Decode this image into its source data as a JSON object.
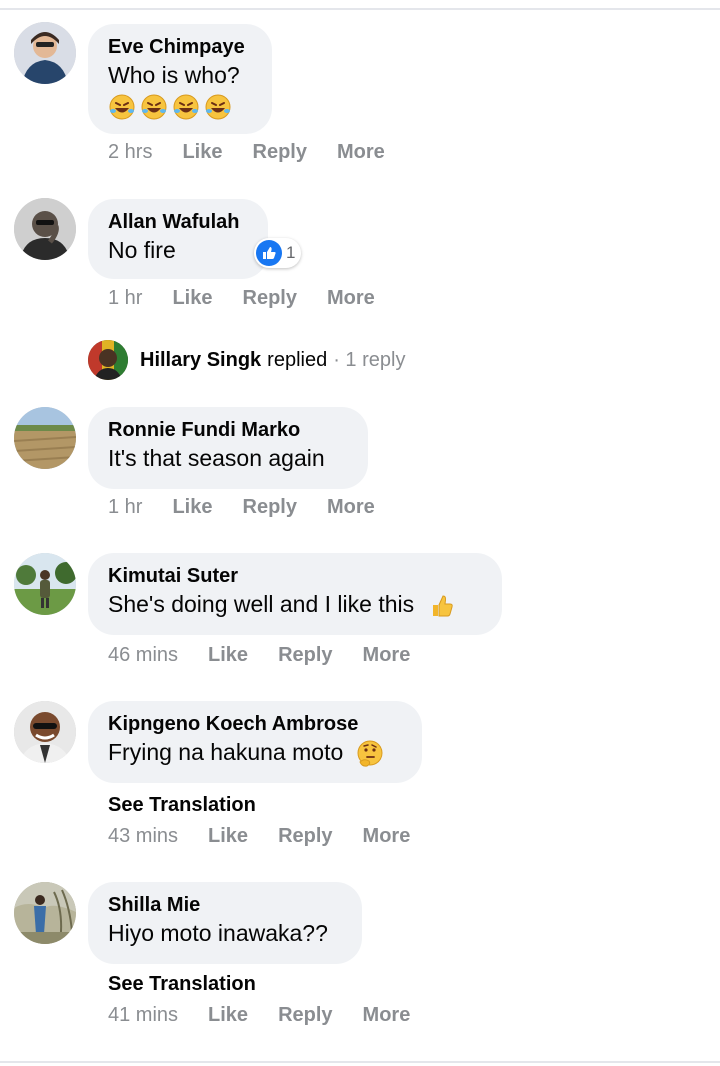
{
  "comments": [
    {
      "author": "Eve Chimpaye",
      "text": "Who is who?",
      "emojis": [
        "laughing-crying-emoji",
        "laughing-crying-emoji",
        "laughing-crying-emoji",
        "laughing-crying-emoji"
      ],
      "time": "2 hrs",
      "like": "Like",
      "reply": "Reply",
      "more": "More"
    },
    {
      "author": "Allan Wafulah",
      "text": "No fire",
      "reaction_count": "1",
      "time": "1 hr",
      "like": "Like",
      "reply": "Reply",
      "more": "More"
    },
    {
      "author": "Ronnie Fundi Marko",
      "text": "It's that season again",
      "time": "1 hr",
      "like": "Like",
      "reply": "Reply",
      "more": "More"
    },
    {
      "author": "Kimutai Suter",
      "text": "She's doing well and I like this",
      "emoji": "thumbs-up-emoji",
      "time": "46 mins",
      "like": "Like",
      "reply": "Reply",
      "more": "More"
    },
    {
      "author": "Kipngeno Koech Ambrose",
      "text": "Frying na hakuna moto",
      "emoji": "thinking-face-emoji",
      "see_translation": "See Translation",
      "time": "43 mins",
      "like": "Like",
      "reply": "Reply",
      "more": "More"
    },
    {
      "author": "Shilla Mie",
      "text": "Hiyo moto inawaka??",
      "see_translation": "See Translation",
      "time": "41 mins",
      "like": "Like",
      "reply": "Reply",
      "more": "More"
    }
  ],
  "reply_thread": {
    "name": "Hillary Singk",
    "verb": "replied",
    "count": "· 1 reply"
  },
  "colors": {
    "bubble": "#f0f2f5",
    "meta_text": "#8a8d91",
    "like_blue": "#1877f2",
    "divider": "#e4e6eb"
  }
}
